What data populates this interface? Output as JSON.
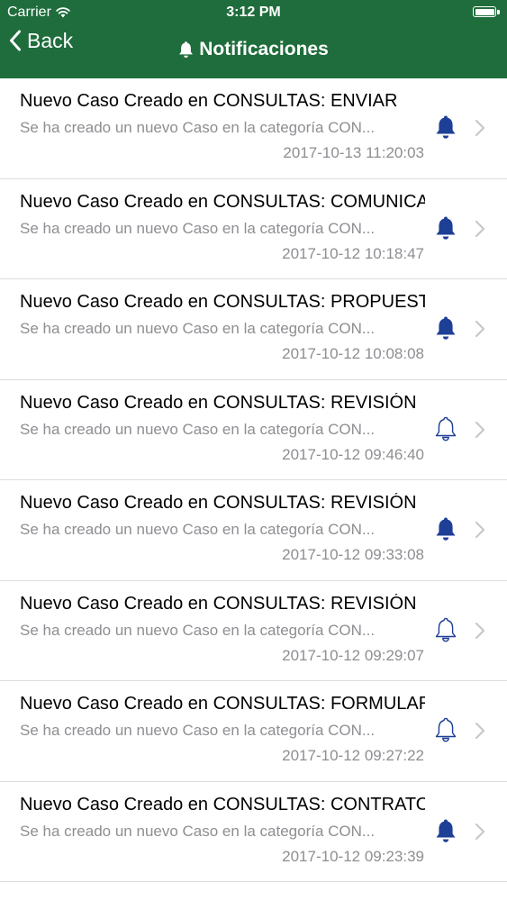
{
  "status_bar": {
    "carrier": "Carrier",
    "time": "3:12 PM"
  },
  "nav": {
    "back_label": "Back",
    "title": "Notificaciones",
    "title_icon": "bell-icon",
    "bar_color": "#1f6d3c"
  },
  "colors": {
    "bell_filled": "#1d3f96",
    "bell_outline": "#1d3f96",
    "secondary_text": "#8e8e93",
    "chevron": "#c7c7cc"
  },
  "notifications": [
    {
      "title": "Nuevo Caso Creado en CONSULTAS: ENVIAR",
      "subtitle": "Se ha creado un nuevo Caso en la categoría CON...",
      "date": "2017-10-13 11:20:03",
      "read": false
    },
    {
      "title": "Nuevo Caso Creado en CONSULTAS: COMUNICACIÓN",
      "subtitle": "Se ha creado un nuevo Caso en la categoría CON...",
      "date": "2017-10-12 10:18:47",
      "read": false
    },
    {
      "title": "Nuevo Caso Creado en CONSULTAS: PROPUESTA",
      "subtitle": "Se ha creado un nuevo Caso en la categoría CON...",
      "date": "2017-10-12 10:08:08",
      "read": false
    },
    {
      "title": "Nuevo Caso Creado en CONSULTAS: REVISIÓN",
      "subtitle": "Se ha creado un nuevo Caso en la categoría CON...",
      "date": "2017-10-12 09:46:40",
      "read": true
    },
    {
      "title": "Nuevo Caso Creado en CONSULTAS: REVISIÓN",
      "subtitle": "Se ha creado un nuevo Caso en la categoría CON...",
      "date": "2017-10-12 09:33:08",
      "read": false
    },
    {
      "title": "Nuevo Caso Creado en CONSULTAS: REVISIÓN",
      "subtitle": "Se ha creado un nuevo Caso en la categoría CON...",
      "date": "2017-10-12 09:29:07",
      "read": true
    },
    {
      "title": "Nuevo Caso Creado en CONSULTAS: FORMULARIO",
      "subtitle": "Se ha creado un nuevo Caso en la categoría CON...",
      "date": "2017-10-12 09:27:22",
      "read": true
    },
    {
      "title": "Nuevo Caso Creado en CONSULTAS: CONTRATO",
      "subtitle": "Se ha creado un nuevo Caso en la categoría CON...",
      "date": "2017-10-12 09:23:39",
      "read": false
    }
  ]
}
